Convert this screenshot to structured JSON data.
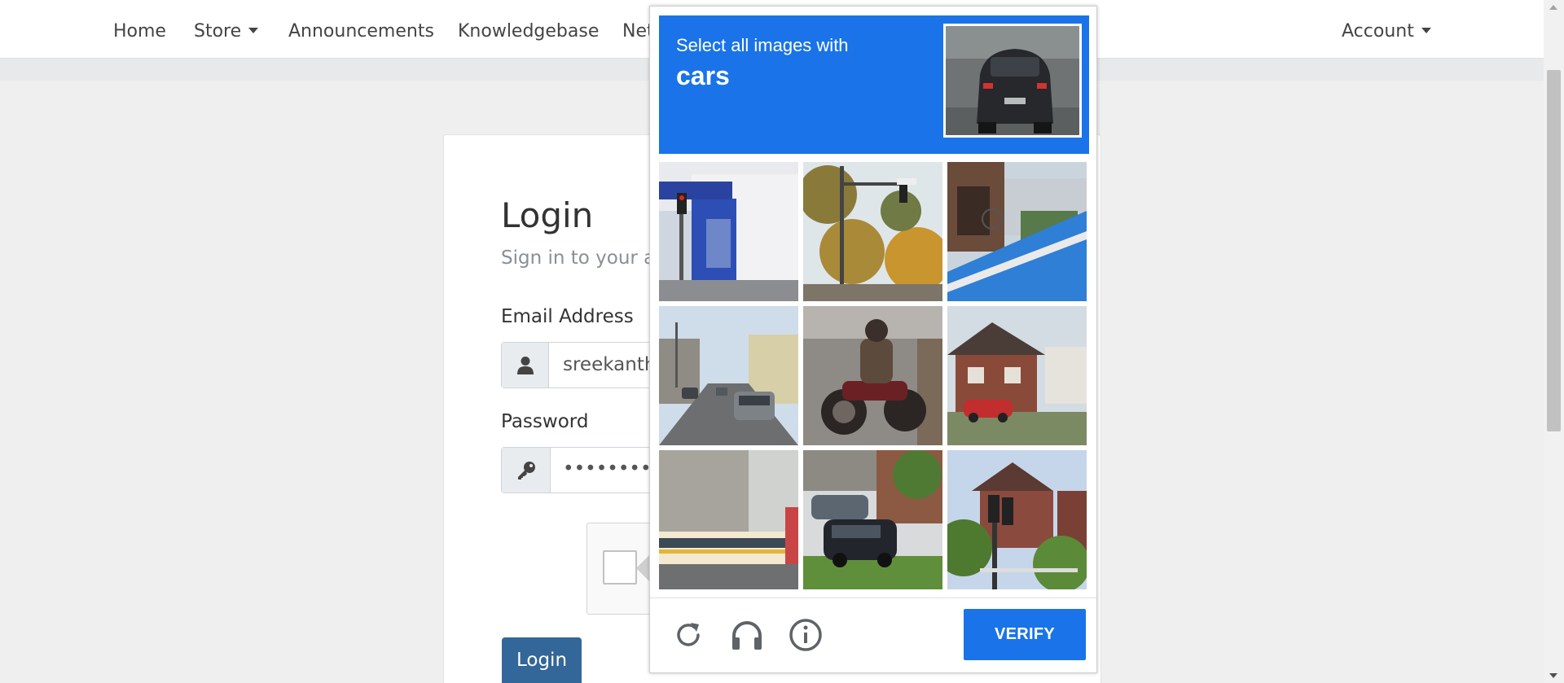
{
  "nav": {
    "items": [
      "Home",
      "Store",
      "Announcements",
      "Knowledgebase",
      "Net"
    ],
    "account": "Account"
  },
  "login": {
    "title": "Login",
    "subtitle": "Sign in to your a",
    "email_label": "Email Address",
    "email_value": "sreekanth",
    "password_label": "Password",
    "password_value": "•••••••••",
    "button": "Login"
  },
  "captcha": {
    "instruction": "Select all images with",
    "keyword": "cars",
    "verify_label": "VERIFY",
    "tiles": [
      "storefront-traffic-light",
      "traffic-light-trees",
      "bike-lane-shop",
      "street-with-cars",
      "motorcycle",
      "house-with-red-car",
      "tram-street",
      "parked-cars",
      "traffic-light-houses"
    ],
    "footer_icons": [
      "reload-icon",
      "audio-headphones-icon",
      "info-icon"
    ],
    "accent_color": "#1a73e8"
  }
}
